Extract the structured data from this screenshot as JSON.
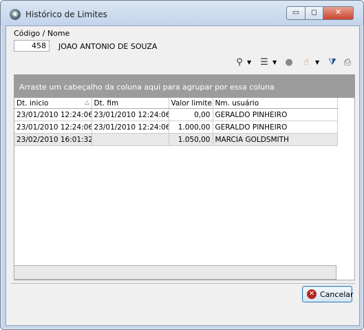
{
  "window": {
    "title": "Histórico de Limites"
  },
  "form": {
    "codigo_nome_label": "Código / Nome",
    "codigo_value": "458",
    "nome_value": "JOAO ANTONIO DE SOUZA"
  },
  "grid": {
    "group_hint": "Arraste um cabeçalho da coluna aqui para agrupar por essa coluna",
    "columns": [
      "Dt. inicio",
      "Dt. fim",
      "Valor limite",
      "Nm. usuário"
    ],
    "rows": [
      [
        "23/01/2010 12:24:06",
        "23/01/2010 12:24:06",
        "0,00",
        "GERALDO PINHEIRO"
      ],
      [
        "23/01/2010 12:24:06",
        "23/01/2010 12:24:06",
        "1.000,00",
        "GERALDO PINHEIRO"
      ],
      [
        "23/02/2010 16:01:32",
        "",
        "1.050,00",
        "MARCIA GOLDSMITH"
      ]
    ]
  },
  "buttons": {
    "cancel_label": "Cancelar"
  },
  "toolbar_icons": [
    "tree-icon",
    "list-options-icon",
    "circle-icon",
    "hand-icon",
    "filter-icon",
    "print-icon"
  ]
}
